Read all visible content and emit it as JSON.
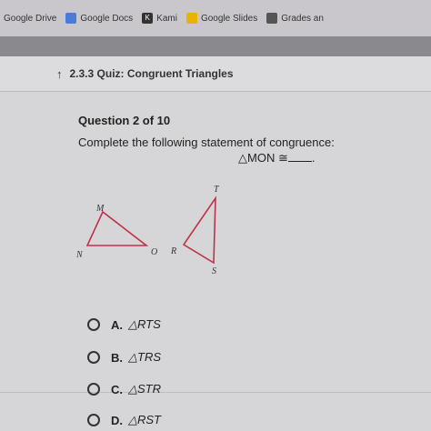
{
  "bookmarks": [
    {
      "label": "Google Drive",
      "icon": "drive-icon"
    },
    {
      "label": "Google Docs",
      "icon": "docs-icon"
    },
    {
      "label": "Kami",
      "icon": "kami-icon"
    },
    {
      "label": "Google Slides",
      "icon": "slides-icon"
    },
    {
      "label": "Grades an",
      "icon": "grades-icon"
    }
  ],
  "quiz": {
    "back_arrow": "↑",
    "title": "2.3.3 Quiz: Congruent Triangles"
  },
  "question": {
    "number": "Question 2 of 10",
    "prompt": "Complete the following statement of congruence:",
    "statement": "△MON ≅",
    "statement_end": "."
  },
  "figure": {
    "left_triangle": {
      "M": "M",
      "N": "N",
      "O": "O"
    },
    "right_triangle": {
      "T": "T",
      "R": "R",
      "S": "S"
    }
  },
  "choices": [
    {
      "letter": "A.",
      "answer": "△RTS"
    },
    {
      "letter": "B.",
      "answer": "△TRS"
    },
    {
      "letter": "C.",
      "answer": "△STR"
    },
    {
      "letter": "D.",
      "answer": "△RST"
    }
  ]
}
